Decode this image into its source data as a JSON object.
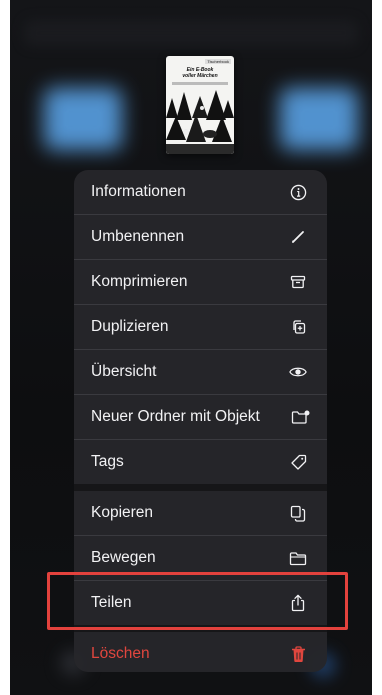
{
  "thumbnail": {
    "badge": "Tischerbook",
    "title_line1": "Ein E-Book",
    "title_line2": "voller Märchen"
  },
  "menu": {
    "items": [
      {
        "label": "Informationen",
        "icon": "info-icon"
      },
      {
        "label": "Umbenennen",
        "icon": "pencil-icon"
      },
      {
        "label": "Komprimieren",
        "icon": "archive-box-icon"
      },
      {
        "label": "Duplizieren",
        "icon": "duplicate-icon"
      },
      {
        "label": "Übersicht",
        "icon": "eye-icon"
      },
      {
        "label": "Neuer Ordner mit Objekt",
        "icon": "folder-badge-icon"
      },
      {
        "label": "Tags",
        "icon": "tag-icon"
      },
      {
        "label": "Kopieren",
        "icon": "copy-document-icon"
      },
      {
        "label": "Bewegen",
        "icon": "folder-icon"
      },
      {
        "label": "Teilen",
        "icon": "share-icon"
      },
      {
        "label": "Löschen",
        "icon": "trash-icon"
      }
    ]
  },
  "colors": {
    "menu_background": "#26262a",
    "text": "#f2f2f4",
    "destructive": "#e0463e",
    "highlight": "#e3423d",
    "folder_blue": "#5da9f0"
  }
}
